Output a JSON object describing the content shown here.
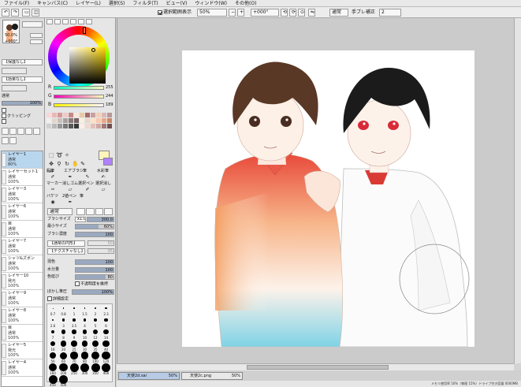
{
  "menu": {
    "items": [
      "ファイル(F)",
      "キャンバス(C)",
      "レイヤー(L)",
      "選択(S)",
      "フィルタ(T)",
      "ビュー(V)",
      "ウィンドウ(W)",
      "その他(O)"
    ]
  },
  "toolbar": {
    "show_selection_label": "選択範囲表示",
    "zoom": "50%",
    "rotation": "+000°",
    "blend": "通常",
    "stabilizer_label": "手ブレ補正",
    "stabilizer_value": "2"
  },
  "navigator": {
    "zoom": "50.0%",
    "angle": "+000°"
  },
  "layer_panel": {
    "protect_label": "【保護なし】",
    "effect_label": "【効果なし】",
    "blend": "通常",
    "opacity": "100%",
    "clip_label": "クリッピング",
    "layers": [
      {
        "name": "レイヤー1",
        "mode": "通常",
        "opacity": "80%",
        "selected": true
      },
      {
        "name": "レイヤーセット1",
        "mode": "通常",
        "opacity": "100%"
      },
      {
        "name": "レイヤー3",
        "mode": "通常",
        "opacity": "100%"
      },
      {
        "name": "レイヤー6",
        "mode": "通常",
        "opacity": "100%"
      },
      {
        "name": "目",
        "mode": "通常",
        "opacity": "100%"
      },
      {
        "name": "レイヤー7",
        "mode": "通常",
        "opacity": "100%"
      },
      {
        "name": "シャツ&ズボン",
        "mode": "通常",
        "opacity": "100%"
      },
      {
        "name": "レイヤー10",
        "mode": "発光",
        "opacity": "100%"
      },
      {
        "name": "レイヤー9",
        "mode": "通常",
        "opacity": "100%",
        "highlight": true
      },
      {
        "name": "レイヤー8",
        "mode": "通常",
        "opacity": "100%"
      },
      {
        "name": "目",
        "mode": "通常",
        "opacity": "100%"
      },
      {
        "name": "レイヤー5",
        "mode": "発光",
        "opacity": "100%"
      },
      {
        "name": "レイヤー4",
        "mode": "通常",
        "opacity": "100%"
      }
    ]
  },
  "color": {
    "r_label": "R",
    "r_value": "255",
    "g_label": "G",
    "g_value": "244",
    "b_label": "B",
    "b_value": "189",
    "foreground": "#fff4bd",
    "background": "#b080ff"
  },
  "tools": {
    "names": [
      "鉛筆",
      "エアブラシ",
      "筆",
      "水彩筆",
      "マーカー",
      "消しゴム",
      "選択ペン",
      "選択消し",
      "バケツ",
      "2値ペン",
      "筆",
      "",
      ""
    ]
  },
  "brush": {
    "blend": "通常",
    "size_label": "ブラシサイズ",
    "size_mult": "x1.0",
    "size_value": "300.0",
    "min_size_label": "最小サイズ",
    "min_size_value": "60%",
    "density_label": "ブラシ濃度",
    "density_value": "100",
    "shape_label": "【通常の円形】",
    "shape_value": "50",
    "texture_label": "【テクスチャなし】",
    "texture_value": "95",
    "blending_label": "混色",
    "blending_value": "100",
    "water_label": "水分量",
    "water_value": "100",
    "persistence_label": "色延び",
    "persistence_value": "80",
    "keep_opacity_label": "不透明度を維持",
    "blur_label": "ぼかし筆圧",
    "blur_value": "100%",
    "detail_label": "詳細設定",
    "sizes": [
      "0.7",
      "0.8",
      "1",
      "1.5",
      "2",
      "2.3",
      "2.6",
      "3",
      "3.5",
      "4",
      "5",
      "6",
      "7",
      "8",
      "9",
      "10",
      "12",
      "14",
      "16",
      "20",
      "25",
      "30",
      "35",
      "40",
      "50",
      "60",
      "70",
      "80",
      "100",
      "120",
      "160",
      "200",
      "250",
      "300",
      "350",
      "400",
      "450",
      "500"
    ]
  },
  "documents": {
    "tabs": [
      {
        "name": "天使2d.sai",
        "zoom": "50%"
      },
      {
        "name": "天使2c.png",
        "zoom": "50%"
      }
    ]
  },
  "status": {
    "text": "メモリ使用率 50%（物理 15%）ドライブ空き容量 0000MB"
  }
}
